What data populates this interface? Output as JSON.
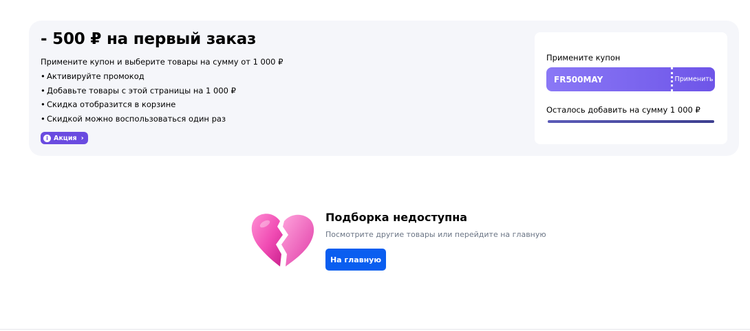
{
  "promo": {
    "title": "- 500 ₽ на первый заказ",
    "subtitle": "Примените купон и выберите товары на сумму от 1 000 ₽",
    "bullets": [
      "Активируйте промокод",
      "Добавьте товары с этой страницы на 1 000 ₽",
      "Скидка отобразится в корзине",
      "Скидкой можно воспользоваться один раз"
    ],
    "badge_label": "Акция",
    "badge_icon": "info-icon"
  },
  "coupon": {
    "label": "Примените купон",
    "code": "FR500MAY",
    "apply_label": "Применить",
    "remaining_label": "Осталось добавить на сумму 1 000 ₽",
    "progress_fraction": 1.0,
    "accent_color": "#6e55e8"
  },
  "empty_state": {
    "icon": "broken-heart-icon",
    "title": "Подборка недоступна",
    "text": "Посмотрите другие товары или перейдите на главную",
    "button_label": "На главную",
    "button_color": "#0a5ef0"
  }
}
